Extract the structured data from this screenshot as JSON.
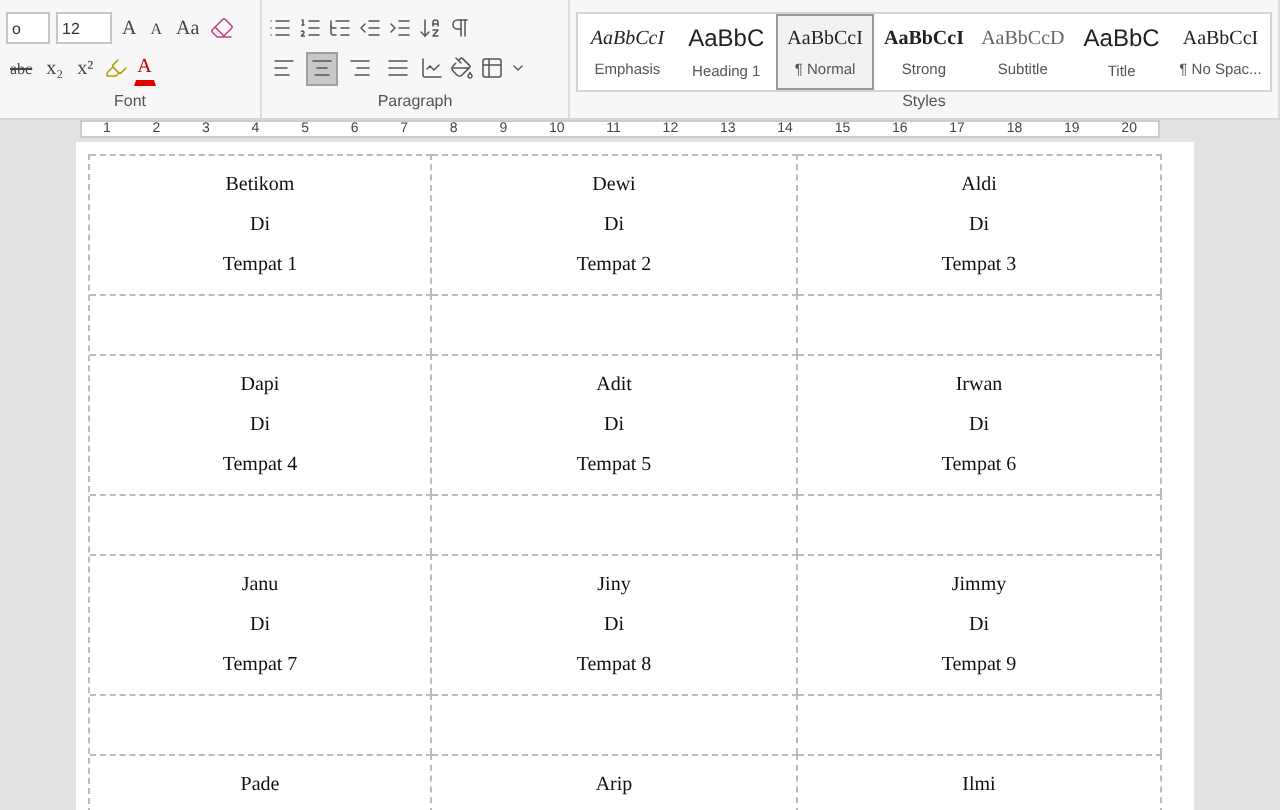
{
  "ribbon": {
    "font": {
      "name": "o",
      "size": "12",
      "grow": "A",
      "shrink": "A",
      "case": "Aa",
      "strike": "abc",
      "subscript": "x₂",
      "superscript": "x²",
      "color_letter": "A",
      "label": "Font"
    },
    "paragraph": {
      "label": "Paragraph",
      "alignments": [
        {
          "kind": "left",
          "selected": false
        },
        {
          "kind": "center",
          "selected": true
        },
        {
          "kind": "right",
          "selected": false
        },
        {
          "kind": "justify",
          "selected": false
        }
      ]
    },
    "styles": {
      "label": "Styles",
      "items": [
        {
          "preview": "AaBbCcI",
          "name": "Emphasis",
          "kind": "italic",
          "selected": false
        },
        {
          "preview": "AaBbC",
          "name": "Heading 1",
          "kind": "heading",
          "selected": false
        },
        {
          "preview": "AaBbCcI",
          "name": "¶ Normal",
          "kind": "normal",
          "selected": true
        },
        {
          "preview": "AaBbCcI",
          "name": "Strong",
          "kind": "strong",
          "selected": false
        },
        {
          "preview": "AaBbCcD",
          "name": "Subtitle",
          "kind": "subtitle",
          "selected": false
        },
        {
          "preview": "AaBbC",
          "name": "Title",
          "kind": "heading",
          "selected": false
        },
        {
          "preview": "AaBbCcI",
          "name": "¶ No Spac...",
          "kind": "normal",
          "selected": false
        }
      ]
    }
  },
  "ruler": [
    "1",
    "2",
    "3",
    "4",
    "5",
    "6",
    "7",
    "8",
    "9",
    "10",
    "11",
    "12",
    "13",
    "14",
    "15",
    "16",
    "17",
    "18",
    "19",
    "20"
  ],
  "table": {
    "rows": [
      [
        {
          "name": "Betikom",
          "at": "Di",
          "place": "Tempat 1"
        },
        {
          "name": "Dewi",
          "at": "Di",
          "place": "Tempat 2"
        },
        {
          "name": "Aldi",
          "at": "Di",
          "place": "Tempat 3"
        }
      ],
      [
        {
          "name": "Dapi",
          "at": "Di",
          "place": "Tempat 4"
        },
        {
          "name": "Adit",
          "at": "Di",
          "place": "Tempat 5"
        },
        {
          "name": "Irwan",
          "at": "Di",
          "place": "Tempat 6"
        }
      ],
      [
        {
          "name": "Janu",
          "at": "Di",
          "place": "Tempat 7"
        },
        {
          "name": "Jiny",
          "at": "Di",
          "place": "Tempat 8"
        },
        {
          "name": "Jimmy",
          "at": "Di",
          "place": "Tempat 9"
        }
      ],
      [
        {
          "name": "Pade"
        },
        {
          "name": "Arip"
        },
        {
          "name": "Ilmi"
        }
      ]
    ]
  }
}
